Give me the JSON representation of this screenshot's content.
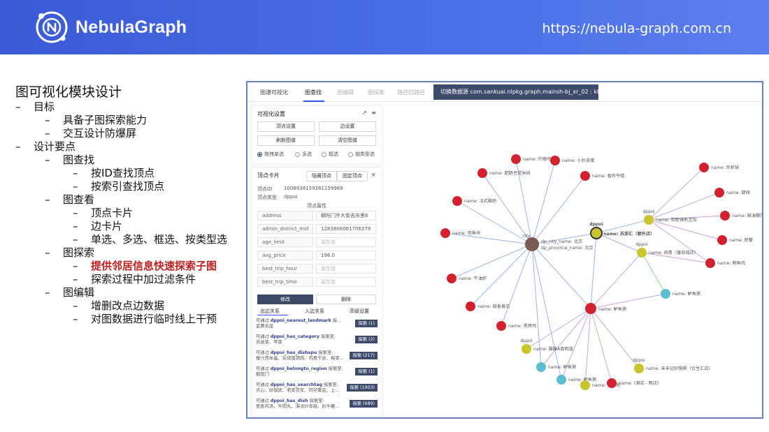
{
  "header": {
    "brand": "NebulaGraph",
    "url": "https://nebula-graph.com.cn",
    "colors": {
      "banner": "#4a6fe6"
    }
  },
  "outline": {
    "title": "图可视化模块设计",
    "items": [
      {
        "level": 1,
        "text": "目标"
      },
      {
        "level": 2,
        "text": "具备子图探索能力"
      },
      {
        "level": 2,
        "text": "交互设计防爆屏"
      },
      {
        "level": 1,
        "text": "设计要点"
      },
      {
        "level": 2,
        "text": "图查找"
      },
      {
        "level": 3,
        "text": "按ID查找顶点"
      },
      {
        "level": 3,
        "text": "按索引查找顶点"
      },
      {
        "level": 2,
        "text": "图查看"
      },
      {
        "level": 3,
        "text": "顶点卡片"
      },
      {
        "level": 3,
        "text": "边卡片"
      },
      {
        "level": 3,
        "text": "单选、多选、框选、按类型选"
      },
      {
        "level": 2,
        "text": "图探索"
      },
      {
        "level": 3,
        "text": "提供邻居信息快速探索子图",
        "highlight": true
      },
      {
        "level": 3,
        "text": "探索过程中加过滤条件"
      },
      {
        "level": 2,
        "text": "图编辑"
      },
      {
        "level": 3,
        "text": "增删改点边数据"
      },
      {
        "level": 3,
        "text": "对图数据进行临时线上干预"
      }
    ]
  },
  "app": {
    "tabs": [
      {
        "label": "图谱可视化",
        "state": "normal"
      },
      {
        "label": "图查找",
        "state": "active"
      },
      {
        "label": "图编辑",
        "state": "dim"
      },
      {
        "label": "图探索",
        "state": "dim"
      },
      {
        "label": "路径回路径",
        "state": "dim"
      }
    ],
    "switch_db": "切换数据源 com.sankuai.nlpkg.graph.mainsh-bj_xr_02 : kbqa",
    "settings": {
      "title": "可视化设置",
      "icons": [
        "share-icon",
        "menu-icon"
      ],
      "buttons": [
        "顶点设置",
        "边设置",
        "刷新图谱",
        "清空图谱"
      ],
      "radios": [
        {
          "label": "拖拽单选",
          "checked": true
        },
        {
          "label": "多选",
          "checked": false
        },
        {
          "label": "框选",
          "checked": false
        },
        {
          "label": "按类型选",
          "checked": false
        }
      ]
    },
    "vertex_card": {
      "title": "顶点卡片",
      "hide_button": "隐藏顶点",
      "pin_button": "固定顶点",
      "close": "×",
      "id_label": "顶点ID",
      "id_value": "1008938159381159969",
      "type_label": "顶点类型",
      "type_value": "dppoi",
      "props_title": "顶点属性",
      "props": [
        {
          "key": "address",
          "value": "朝阳门外大街吉庆里6",
          "placeholder": false
        },
        {
          "key": "admin_district_mid",
          "value": "1283806061706379",
          "placeholder": false
        },
        {
          "key": "age_limit",
          "value": "属性值",
          "placeholder": true
        },
        {
          "key": "avg_price",
          "value": "198.0",
          "placeholder": false
        },
        {
          "key": "best_trip_hour",
          "value": "属性值",
          "placeholder": true
        },
        {
          "key": "best_trip_time",
          "value": "属性值",
          "placeholder": true
        }
      ],
      "edit_button": "修改",
      "delete_button": "删除",
      "subtabs": [
        "出边关系",
        "入边关系",
        "高级设置"
      ],
      "relations": [
        {
          "prefix": "可通过",
          "name": "dppoi_nearest_landmark",
          "suffix": "探索至:",
          "detail": "蓝菁名座",
          "button": "探索 (1)"
        },
        {
          "prefix": "可通过",
          "name": "dppoi_has_category",
          "suffix": "探索至:",
          "detail": "苏浙菜、苹菜",
          "button": "探索 (2)"
        },
        {
          "prefix": "可通过",
          "name": "dppoi_has_dishspu",
          "suffix": "探索至:",
          "detail": "樱汁西米露、炭烧猪颈肉、鸡煮干丝、梅菜...",
          "button": "探索 (217)"
        },
        {
          "prefix": "可通过",
          "name": "dppoi_belongto_region",
          "suffix": "探索至:",
          "detail": "朝阳门",
          "button": "探索 (1)"
        },
        {
          "prefix": "可通过",
          "name": "dppoi_has_searchtag",
          "suffix": "探索至:",
          "detail": "点心、砂锅煲、老菜豆浆、同学聚会、上...",
          "button": "探索 (1903)"
        },
        {
          "prefix": "可通过",
          "name": "dppoi_has_dish",
          "suffix": "探索至:",
          "detail": "葱香鸡汤、牛肉丸、海派炒年糕、扒牛鞭...",
          "button": "探索 (689)"
        }
      ]
    },
    "graph": {
      "colors": {
        "red": "#d2222f",
        "olive": "#c8c62c",
        "teal": "#5bbfcf",
        "brown": "#7a5a52",
        "edge": "#9bb4e6",
        "edge2": "#c7a4e2"
      },
      "hub": {
        "label1": "dp_city_name: 北京",
        "label2": "dp_province_name: 北京",
        "tag": "city"
      },
      "focus": {
        "tag": "dppoi",
        "label": "name: 苏浙汇（朝外店）"
      },
      "mid": {
        "label": "name: 鲈鱼粥"
      },
      "labels": {
        "n1": "name: 柠檬鸡翅",
        "n2": "name: 小炒皮蛋",
        "n3": "name: 肥肠豆花米线",
        "n4": "name: 香炸牛蛙",
        "n5": "name: 法式酸奶",
        "n6": "name: 坦鱼块",
        "n7": "name: 牛油虾",
        "n8": "name: 鼓香黄瓜",
        "n9": "name: 黑烤鸡",
        "r1": "name: 炸虾球",
        "r2": "name: 腊排",
        "r3": "name: 麻油糯花",
        "r4": "name: 粉蟹",
        "r5": "name: 鲍鱼肉",
        "o1": "name: 和睦锋新艺馆",
        "o1tag": "dppoi",
        "o2": "name: 纯粤（番前城店）",
        "o2tag": "dppoi",
        "t1": "name: 鲈鱼粥",
        "o3": "name: 躁躁A真明道",
        "o3tag": "dppoi",
        "t2": "name: 鲈鱼粥",
        "t3": "name: 鲈鱼粥",
        "o4": "name: 禾丰记砂锅粥（合生汇店）",
        "o4tag": "dppoi",
        "o5": "name: 鲈鱼粥",
        "r6": "name: (酒店 - 雨店)"
      }
    }
  }
}
